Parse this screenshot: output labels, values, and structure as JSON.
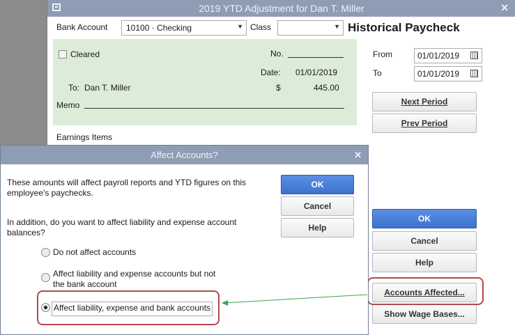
{
  "window": {
    "title": "2019 YTD Adjustment for Dan T. Miller"
  },
  "header": {
    "bank_account_label": "Bank Account",
    "bank_account_value": "10100 · Checking",
    "class_label": "Class",
    "class_value": "",
    "heading": "Historical Paycheck"
  },
  "check": {
    "cleared_label": "Cleared",
    "no_label": "No.",
    "date_label": "Date:",
    "date_value": "01/01/2019",
    "to_label": "To:",
    "payee": "Dan T. Miller",
    "currency": "$",
    "amount": "445.00",
    "memo_label": "Memo"
  },
  "earnings_label": "Earnings Items",
  "period": {
    "from_label": "From",
    "from_value": "01/01/2019",
    "to_label": "To",
    "to_value": "01/01/2019",
    "next_label": "Next Period",
    "prev_label": "Prev Period"
  },
  "actions": {
    "ok": "OK",
    "cancel": "Cancel",
    "help": "Help",
    "accounts_affected": "Accounts Affected...",
    "show_wage_bases": "Show Wage Bases..."
  },
  "dialog": {
    "title": "Affect Accounts?",
    "text1_line1": "These amounts will affect payroll reports and YTD figures on this",
    "text1_line2": "employee's paychecks.",
    "text2_line1": "In addition, do you want to affect liability and expense account",
    "text2_line2": "balances?",
    "option1": "Do not affect accounts",
    "option2_line1": "Affect liability and expense accounts but not",
    "option2_line2": "the bank account",
    "option3": "Affect liability, expense and bank accounts",
    "ok": "OK",
    "cancel": "Cancel",
    "help": "Help"
  },
  "colors": {
    "titlebar": "#8e9db4",
    "check_bg": "#dcecd9",
    "primary": "#3d72cf",
    "highlight": "#b5474b",
    "arrow": "#3ba34b"
  }
}
